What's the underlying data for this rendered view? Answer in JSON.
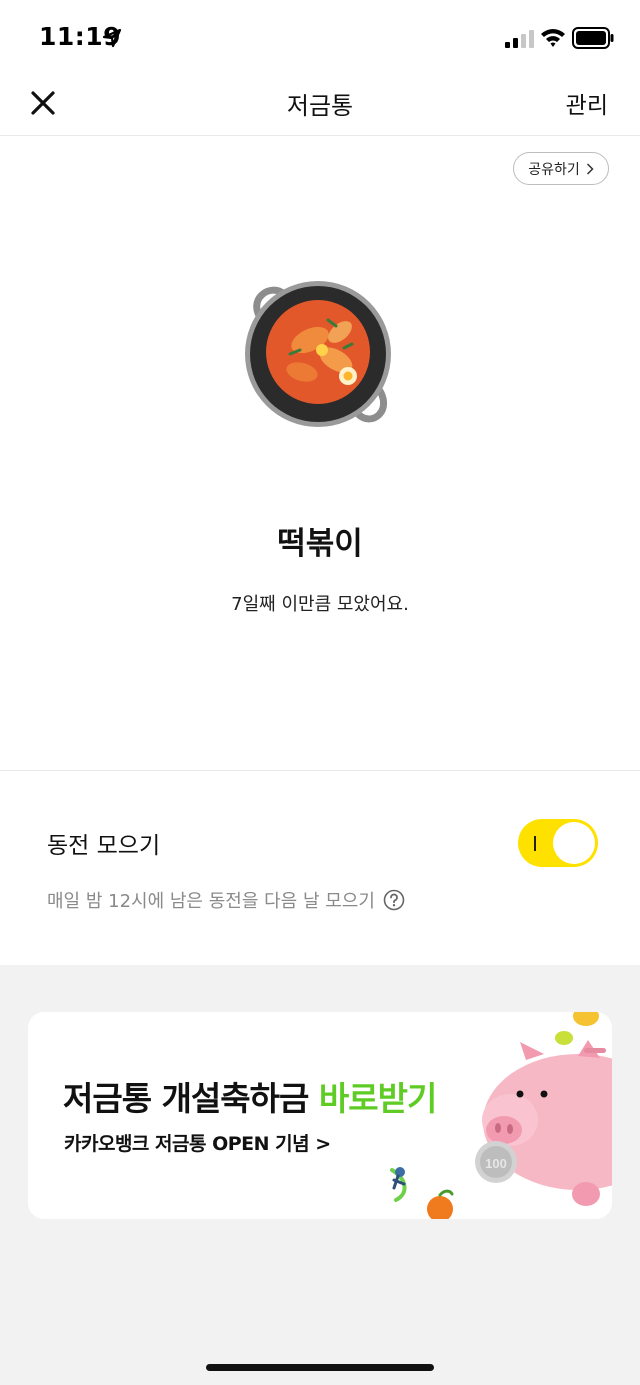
{
  "status_bar": {
    "time": "11:19",
    "icons": [
      "location-arrow-icon",
      "signal-icon",
      "wifi-icon",
      "battery-icon"
    ]
  },
  "nav": {
    "close_icon": "close-icon",
    "title": "저금통",
    "manage_label": "관리"
  },
  "share_button": {
    "label": "공유하기",
    "icon": "chevron-right-icon"
  },
  "goal": {
    "icon": "tteokbokki-pan-icon",
    "name": "떡볶이",
    "description": "7일째 이만큼 모았어요."
  },
  "coin_collect": {
    "title": "동전 모으기",
    "toggle_on": true,
    "description": "매일 밤 12시에 남은 동전을 다음 날 모으기",
    "help_icon": "question-circle-icon"
  },
  "banner": {
    "title_main": "저금통 개설축하금 ",
    "title_accent": "바로받기",
    "subtitle": "카카오뱅크 저금통 OPEN 기념 >",
    "accent_color": "#5fcc25",
    "coin_label": "100",
    "art_icon": "piggy-bank-illustration"
  },
  "colors": {
    "toggle_bg": "#ffe100",
    "page_bg": "#ffffff",
    "section_bg": "#f2f2f2"
  }
}
